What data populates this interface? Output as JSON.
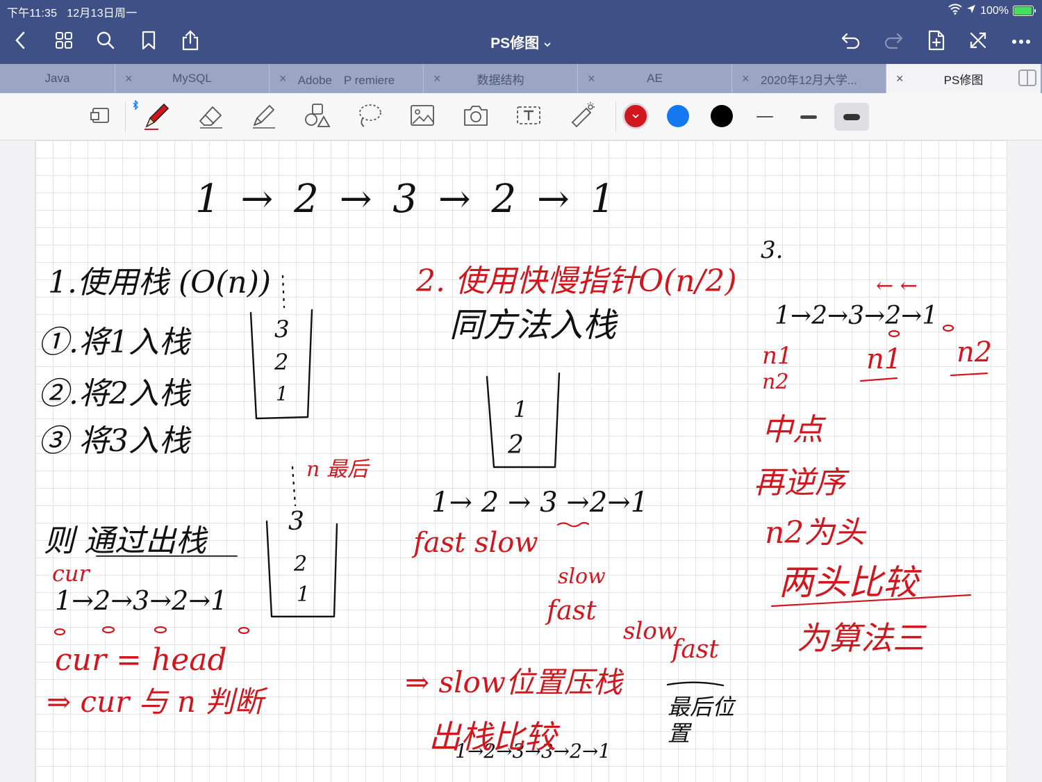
{
  "status": {
    "time": "下午11:35",
    "date": "12月13日周一",
    "battery": "100%",
    "battery_level": 1.0
  },
  "nav": {
    "title": "PS修图",
    "title_caret": "⌄"
  },
  "tabs": [
    {
      "label": "Java"
    },
    {
      "label": "MySQL"
    },
    {
      "label": "Adobe　P remiere"
    },
    {
      "label": "数据结构"
    },
    {
      "label": "AE"
    },
    {
      "label": "2020年12月大学..."
    },
    {
      "label": "PS修图"
    }
  ],
  "tab_close_glyph": "×",
  "tools": {
    "colors": [
      "#d2161e",
      "#1479f0",
      "#000000"
    ],
    "selected_color": "#d2161e",
    "selected_thickness": "thick",
    "eraser_thumb": "⌄"
  },
  "notes": {
    "top_list": "1 → 2 → 3 → 2 → 1",
    "m1_title": "1.使用栈 (O(n))",
    "m1_s1": "①.将1入栈",
    "m1_s2": "②.将2入栈",
    "m1_s3": "③ 将3入栈",
    "stack1": [
      "3",
      "2",
      "1"
    ],
    "n_last": "n 最后",
    "stack2": [
      "3",
      "2",
      "1"
    ],
    "m1_pop": "则 通过出栈",
    "cur": "cur",
    "list_small": "1→2→3→2→1",
    "cur_head": "cur = head",
    "cur_n": "⇒ cur 与 n 判断",
    "m2_title": "2. 使用快慢指针O(n/2)",
    "m2_sub": "同方法入栈",
    "stack3": [
      "1",
      "2"
    ],
    "list_mid": "1→ 2 → 3 →2→1",
    "fast_slow": "fast slow",
    "slow1": "slow",
    "fast1": "fast",
    "slow2": "slow",
    "fast2": "fast",
    "push_slow": "⇒ slow位置压栈",
    "pop_cmp": "出栈比较",
    "last_pos": "最后位置",
    "list_bottom": "1→2→3→3→2→1",
    "m3": "3.",
    "list_right": "1→2→3→2→1",
    "arrows": "←  ←",
    "n1": "n1",
    "n2": "n2",
    "n1b": "n1",
    "n2b": "n2",
    "mid": "中点",
    "reverse": "再逆序",
    "n2_head": "n2为头",
    "both": "两头比较",
    "method3": "为算法三"
  }
}
